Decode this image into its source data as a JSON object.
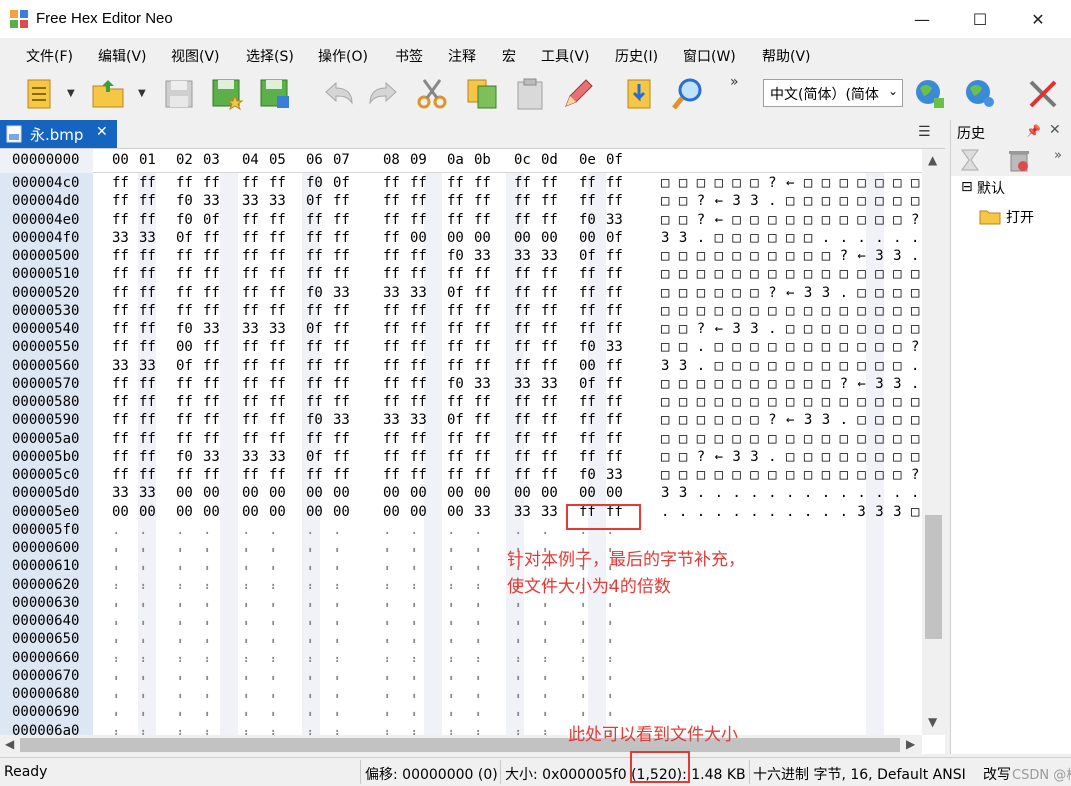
{
  "window": {
    "title": "Free Hex Editor Neo",
    "min": "—",
    "max": "☐",
    "close": "✕"
  },
  "menu": [
    "文件(F)",
    "编辑(V)",
    "视图(V)",
    "选择(S)",
    "操作(O)",
    "书签",
    "注释",
    "宏",
    "工具(V)",
    "历史(I)",
    "窗口(W)",
    "帮助(V)"
  ],
  "toolbar": {
    "icons": [
      "new-file-icon",
      "open-file-icon",
      "save-icon",
      "save-as-icon",
      "save-all-icon",
      "undo-icon",
      "redo-icon",
      "cut-icon",
      "copy-icon",
      "paste-icon",
      "edit-icon",
      "import-icon",
      "find-icon"
    ],
    "language": "中文(简体）(简体",
    "more": "»"
  },
  "tab": {
    "label": "永.bmp",
    "close": "✕",
    "menu": "☰"
  },
  "hex": {
    "header_offset": "00000000",
    "columns": [
      "00",
      "01",
      "02",
      "03",
      "04",
      "05",
      "06",
      "07",
      "08",
      "09",
      "0a",
      "0b",
      "0c",
      "0d",
      "0e",
      "0f"
    ],
    "rows": [
      {
        "off": "000004c0",
        "b": [
          "ff",
          "ff",
          "ff",
          "ff",
          "ff",
          "ff",
          "f0",
          "0f",
          "ff",
          "ff",
          "ff",
          "ff",
          "ff",
          "ff",
          "ff",
          "ff"
        ],
        "a": "□ □ □ □ □ □ ? ← □ □ □ □ □ □ □ □"
      },
      {
        "off": "000004d0",
        "b": [
          "ff",
          "ff",
          "f0",
          "33",
          "33",
          "33",
          "0f",
          "ff",
          "ff",
          "ff",
          "ff",
          "ff",
          "ff",
          "ff",
          "ff",
          "ff"
        ],
        "a": "□ □ ? ← 3 3 . □ □ □ □ □ □ □ □ □"
      },
      {
        "off": "000004e0",
        "b": [
          "ff",
          "ff",
          "f0",
          "0f",
          "ff",
          "ff",
          "ff",
          "ff",
          "ff",
          "ff",
          "ff",
          "ff",
          "ff",
          "ff",
          "f0",
          "33"
        ],
        "a": "□ □ ? ← □ □ □ □ □ □ □ □ □ □ ? ←"
      },
      {
        "off": "000004f0",
        "b": [
          "33",
          "33",
          "0f",
          "ff",
          "ff",
          "ff",
          "ff",
          "ff",
          "ff",
          "00",
          "00",
          "00",
          "00",
          "00",
          "00",
          "0f"
        ],
        "a": "3 3 . □ □ □ □ □ □ . . . . . . ."
      },
      {
        "off": "00000500",
        "b": [
          "ff",
          "ff",
          "ff",
          "ff",
          "ff",
          "ff",
          "ff",
          "ff",
          "ff",
          "ff",
          "f0",
          "33",
          "33",
          "33",
          "0f",
          "ff"
        ],
        "a": "□ □ □ □ □ □ □ □ □ □ ? ← 3 3 . □"
      },
      {
        "off": "00000510",
        "b": [
          "ff",
          "ff",
          "ff",
          "ff",
          "ff",
          "ff",
          "ff",
          "ff",
          "ff",
          "ff",
          "ff",
          "ff",
          "ff",
          "ff",
          "ff",
          "ff"
        ],
        "a": "□ □ □ □ □ □ □ □ □ □ □ □ □ □ □ □"
      },
      {
        "off": "00000520",
        "b": [
          "ff",
          "ff",
          "ff",
          "ff",
          "ff",
          "ff",
          "f0",
          "33",
          "33",
          "33",
          "0f",
          "ff",
          "ff",
          "ff",
          "ff",
          "ff"
        ],
        "a": "□ □ □ □ □ □ ? ← 3 3 . □ □ □ □ □"
      },
      {
        "off": "00000530",
        "b": [
          "ff",
          "ff",
          "ff",
          "ff",
          "ff",
          "ff",
          "ff",
          "ff",
          "ff",
          "ff",
          "ff",
          "ff",
          "ff",
          "ff",
          "ff",
          "ff"
        ],
        "a": "□ □ □ □ □ □ □ □ □ □ □ □ □ □ □ □"
      },
      {
        "off": "00000540",
        "b": [
          "ff",
          "ff",
          "f0",
          "33",
          "33",
          "33",
          "0f",
          "ff",
          "ff",
          "ff",
          "ff",
          "ff",
          "ff",
          "ff",
          "ff",
          "ff"
        ],
        "a": "□ □ ? ← 3 3 . □ □ □ □ □ □ □ □ □"
      },
      {
        "off": "00000550",
        "b": [
          "ff",
          "ff",
          "00",
          "ff",
          "ff",
          "ff",
          "ff",
          "ff",
          "ff",
          "ff",
          "ff",
          "ff",
          "ff",
          "ff",
          "f0",
          "33"
        ],
        "a": "□ □ . □ □ □ □ □ □ □ □ □ □ □ ? ←"
      },
      {
        "off": "00000560",
        "b": [
          "33",
          "33",
          "0f",
          "ff",
          "ff",
          "ff",
          "ff",
          "ff",
          "ff",
          "ff",
          "ff",
          "ff",
          "ff",
          "ff",
          "00",
          "ff"
        ],
        "a": "3 3 . □ □ □ □ □ □ □ □ □ □ □ . □"
      },
      {
        "off": "00000570",
        "b": [
          "ff",
          "ff",
          "ff",
          "ff",
          "ff",
          "ff",
          "ff",
          "ff",
          "ff",
          "ff",
          "f0",
          "33",
          "33",
          "33",
          "0f",
          "ff"
        ],
        "a": "□ □ □ □ □ □ □ □ □ □ ? ← 3 3 . □"
      },
      {
        "off": "00000580",
        "b": [
          "ff",
          "ff",
          "ff",
          "ff",
          "ff",
          "ff",
          "ff",
          "ff",
          "ff",
          "ff",
          "ff",
          "ff",
          "ff",
          "ff",
          "ff",
          "ff"
        ],
        "a": "□ □ □ □ □ □ □ □ □ □ □ □ □ □ □ □"
      },
      {
        "off": "00000590",
        "b": [
          "ff",
          "ff",
          "ff",
          "ff",
          "ff",
          "ff",
          "f0",
          "33",
          "33",
          "33",
          "0f",
          "ff",
          "ff",
          "ff",
          "ff",
          "ff"
        ],
        "a": "□ □ □ □ □ □ ? ← 3 3 . □ □ □ □ □"
      },
      {
        "off": "000005a0",
        "b": [
          "ff",
          "ff",
          "ff",
          "ff",
          "ff",
          "ff",
          "ff",
          "ff",
          "ff",
          "ff",
          "ff",
          "ff",
          "ff",
          "ff",
          "ff",
          "ff"
        ],
        "a": "□ □ □ □ □ □ □ □ □ □ □ □ □ □ □ □"
      },
      {
        "off": "000005b0",
        "b": [
          "ff",
          "ff",
          "f0",
          "33",
          "33",
          "33",
          "0f",
          "ff",
          "ff",
          "ff",
          "ff",
          "ff",
          "ff",
          "ff",
          "ff",
          "ff"
        ],
        "a": "□ □ ? ← 3 3 . □ □ □ □ □ □ □ □ □"
      },
      {
        "off": "000005c0",
        "b": [
          "ff",
          "ff",
          "ff",
          "ff",
          "ff",
          "ff",
          "ff",
          "ff",
          "ff",
          "ff",
          "ff",
          "ff",
          "ff",
          "ff",
          "f0",
          "33"
        ],
        "a": "□ □ □ □ □ □ □ □ □ □ □ □ □ □ ? ←"
      },
      {
        "off": "000005d0",
        "b": [
          "33",
          "33",
          "00",
          "00",
          "00",
          "00",
          "00",
          "00",
          "00",
          "00",
          "00",
          "00",
          "00",
          "00",
          "00",
          "00"
        ],
        "a": "3 3 . . . . . . . . . . . . . ."
      },
      {
        "off": "000005e0",
        "b": [
          "00",
          "00",
          "00",
          "00",
          "00",
          "00",
          "00",
          "00",
          "00",
          "00",
          "00",
          "33",
          "33",
          "33",
          "ff",
          "ff"
        ],
        "a": ". . . . . . . . . . . 3 3 3 □ □"
      },
      {
        "off": "000005f0",
        "b": [],
        "a": ""
      },
      {
        "off": "00000600",
        "b": [],
        "a": ""
      },
      {
        "off": "00000610",
        "b": [],
        "a": ""
      },
      {
        "off": "00000620",
        "b": [],
        "a": ""
      },
      {
        "off": "00000630",
        "b": [],
        "a": ""
      },
      {
        "off": "00000640",
        "b": [],
        "a": ""
      },
      {
        "off": "00000650",
        "b": [],
        "a": ""
      },
      {
        "off": "00000660",
        "b": [],
        "a": ""
      },
      {
        "off": "00000670",
        "b": [],
        "a": ""
      },
      {
        "off": "00000680",
        "b": [],
        "a": ""
      },
      {
        "off": "00000690",
        "b": [],
        "a": ""
      },
      {
        "off": "000006a0",
        "b": [],
        "a": ""
      }
    ],
    "empty_cell": ". ."
  },
  "history": {
    "title": "历史",
    "pin": "📌",
    "close": "✕",
    "more": "»",
    "root": "默认",
    "item": "打开"
  },
  "status": {
    "ready": "Ready",
    "offset": "偏移: 00000000 (0)",
    "size": "大小: 0x000005f0 (1,520): 1.48 KB",
    "mode": "十六进制 字节, 16, Default ANSI",
    "edit": "改写"
  },
  "annotations": {
    "note1_line1": "针对本例子，最后的字节补充，",
    "note1_line2": "使文件大小为4的倍数",
    "note2": "此处可以看到文件大小"
  },
  "watermark": "CSDN @棉睡衣",
  "colors": {
    "tab_active": "#1565c0",
    "offset_bg": "#dde6f3",
    "annotation": "#e53935"
  }
}
